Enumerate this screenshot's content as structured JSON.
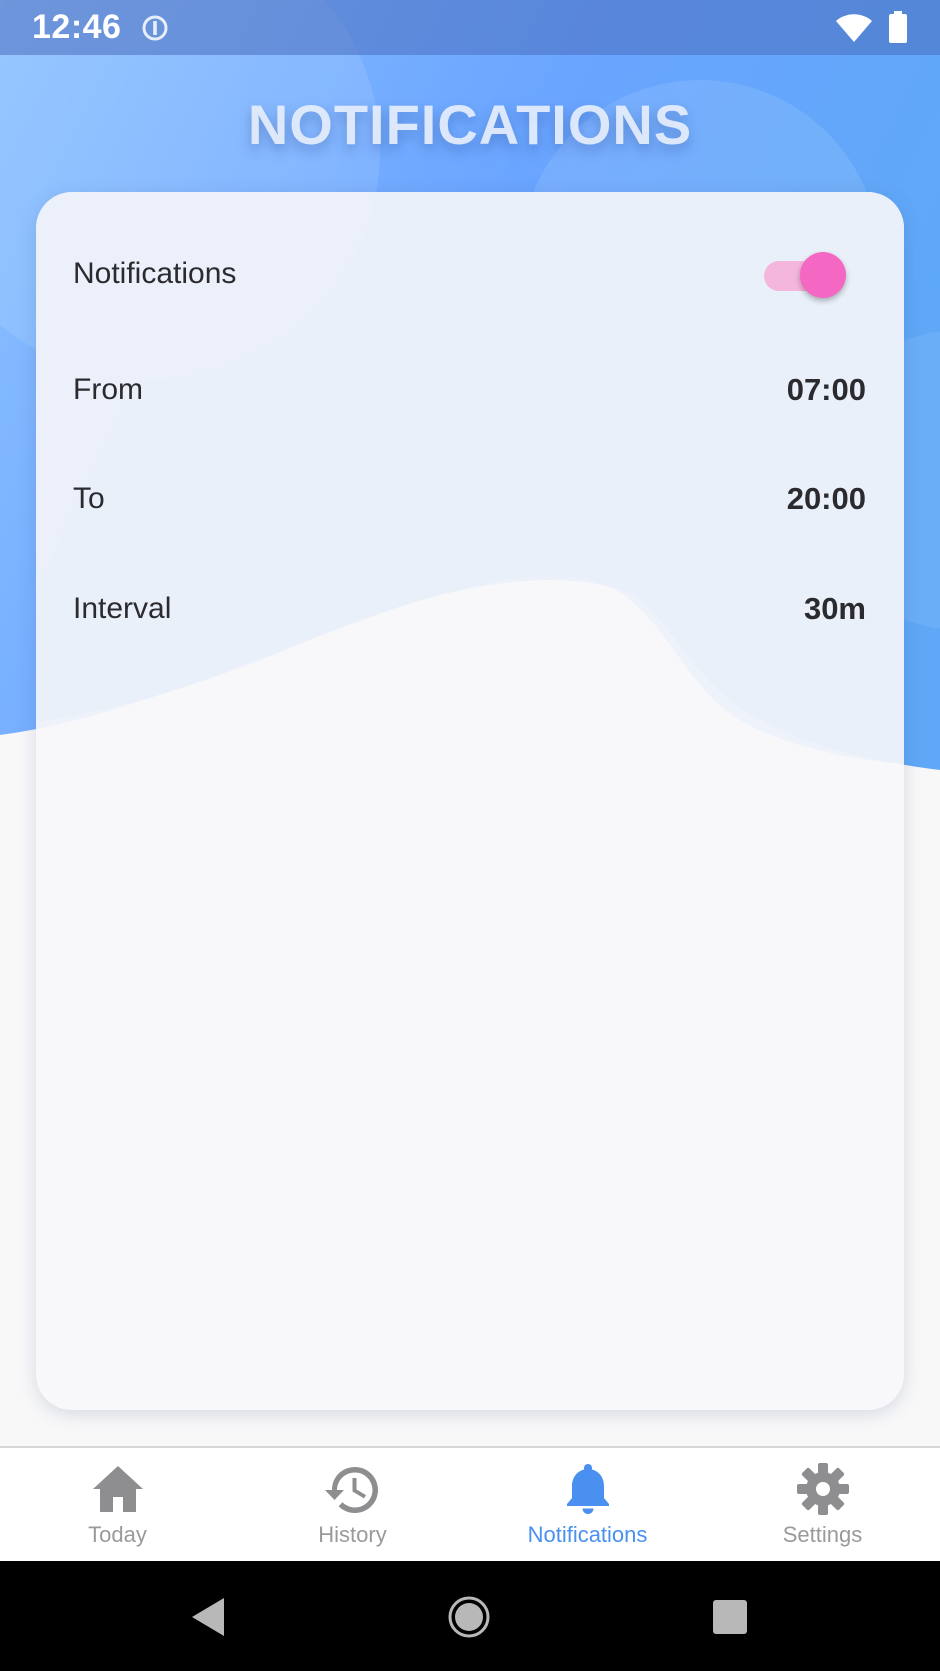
{
  "status_bar": {
    "time": "12:46",
    "icons": [
      "alert-circle-icon",
      "wifi-icon",
      "battery-icon"
    ]
  },
  "page": {
    "title": "NOTIFICATIONS"
  },
  "settings": {
    "notifications": {
      "label": "Notifications",
      "enabled": true
    },
    "from": {
      "label": "From",
      "value": "07:00"
    },
    "to": {
      "label": "To",
      "value": "20:00"
    },
    "interval": {
      "label": "Interval",
      "value": "30m"
    }
  },
  "bottom_nav": {
    "items": [
      {
        "label": "Today",
        "icon": "home-icon",
        "active": false
      },
      {
        "label": "History",
        "icon": "history-icon",
        "active": false
      },
      {
        "label": "Notifications",
        "icon": "bell-icon",
        "active": true
      },
      {
        "label": "Settings",
        "icon": "gear-icon",
        "active": false
      }
    ]
  },
  "colors": {
    "accent_blue": "#4a90f0",
    "toggle_thumb": "#f467c2",
    "toggle_track": "#f4b6dd",
    "inactive_nav": "#9a9a9c",
    "text": "#2b2b2f"
  }
}
